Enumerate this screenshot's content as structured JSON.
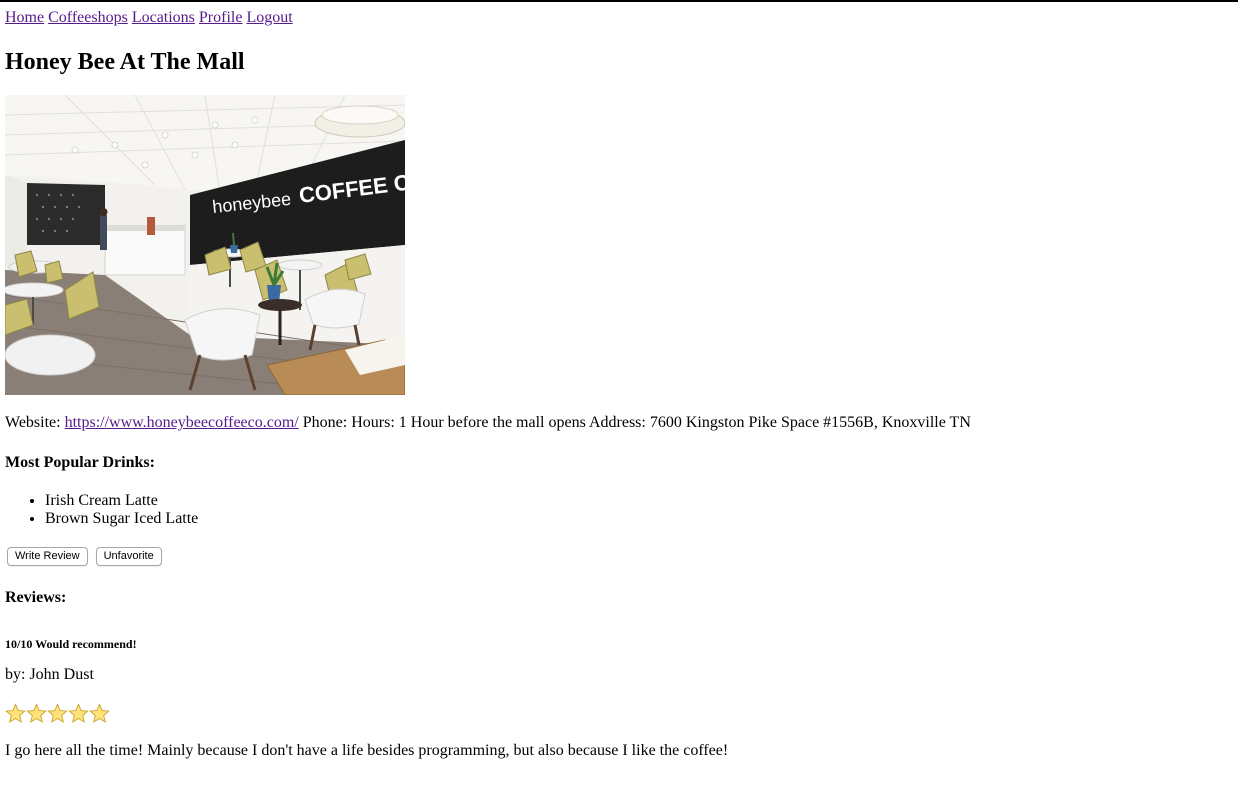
{
  "nav": {
    "home": "Home",
    "coffeeshops": "Coffeeshops",
    "locations": "Locations",
    "profile": "Profile",
    "logout": "Logout"
  },
  "shop": {
    "name": "Honey Bee At The Mall",
    "sign_text_1": "honeybee",
    "sign_text_2": "COFFEE CO.",
    "website_label": "Website:",
    "website_url": "https://www.honeybeecoffeeco.com/",
    "phone_label": "Phone:",
    "hours_label": "Hours:",
    "hours_value": "1 Hour before the mall opens",
    "address_label": "Address:",
    "address_value": "7600 Kingston Pike Space #1556B, Knoxville TN"
  },
  "drinks": {
    "heading": "Most Popular Drinks:",
    "items": [
      "Irish Cream Latte",
      "Brown Sugar Iced Latte"
    ]
  },
  "actions": {
    "write_review": "Write Review",
    "unfavorite": "Unfavorite"
  },
  "reviews": {
    "heading": "Reviews:",
    "items": [
      {
        "title": "10/10 Would recommend!",
        "author_line": "by: John Dust",
        "rating": 5,
        "body": "I go here all the time! Mainly because I don't have a life besides programming, but also because I like the coffee!"
      }
    ]
  },
  "colors": {
    "link": "#551a8b",
    "star_fill": "#ffe27a",
    "star_stroke": "#c9a227"
  },
  "icons": {
    "star": "star-icon"
  }
}
